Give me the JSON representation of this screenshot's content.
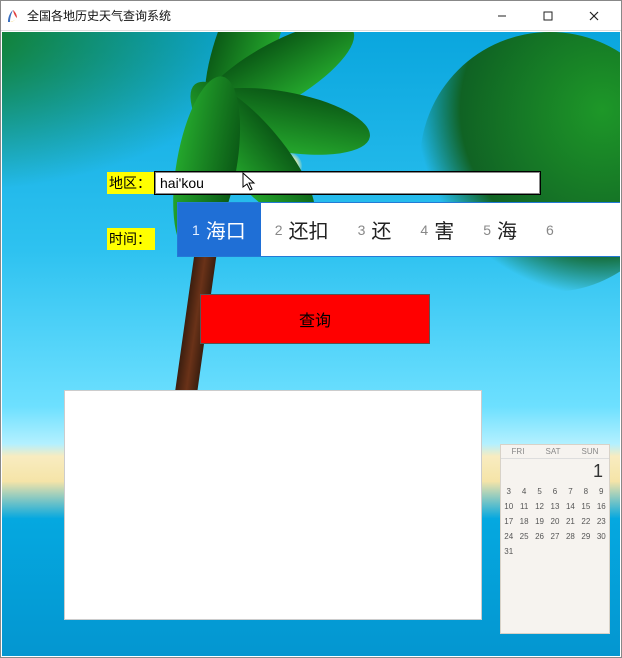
{
  "window": {
    "title": "全国各地历史天气查询系统"
  },
  "labels": {
    "region": "地区：",
    "time": "时间："
  },
  "inputs": {
    "region_value": "hai'kou",
    "time_value": ""
  },
  "ime": {
    "candidates": [
      {
        "num": "1",
        "text": "海口",
        "selected": true
      },
      {
        "num": "2",
        "text": "还扣",
        "selected": false
      },
      {
        "num": "3",
        "text": "还",
        "selected": false
      },
      {
        "num": "4",
        "text": "害",
        "selected": false
      },
      {
        "num": "5",
        "text": "海",
        "selected": false
      },
      {
        "num": "6",
        "text": "",
        "selected": false
      }
    ]
  },
  "buttons": {
    "query": "查询"
  },
  "calendar": {
    "day_headers": [
      "FRI",
      "SAT",
      "SUN"
    ],
    "big_day": "1"
  }
}
